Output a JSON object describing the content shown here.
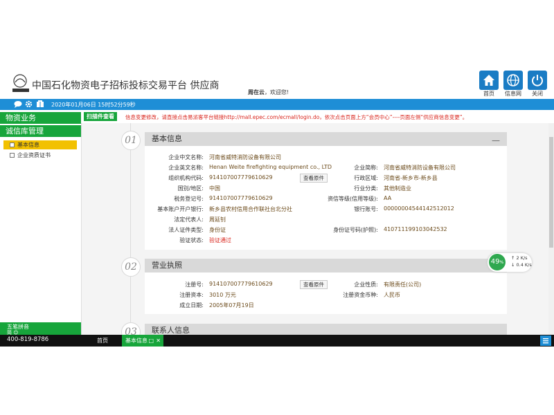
{
  "header": {
    "platform_title": "中国石化物资电子招标投标交易平台 供应商",
    "welcome_name": "周在云",
    "welcome_text": "，欢迎您!",
    "buttons": [
      {
        "label": "首页",
        "icon": "home-icon"
      },
      {
        "label": "信息网",
        "icon": "globe-icon"
      },
      {
        "label": "关闭",
        "icon": "power-icon"
      }
    ]
  },
  "topbar": {
    "datetime": "2020年01月06日 15时52分59秒",
    "icons": [
      "chat-icon",
      "gear-icon",
      "book-icon"
    ]
  },
  "sidebar": {
    "sections": [
      "物资业务",
      "诚信库管理"
    ],
    "items": [
      {
        "label": "基本信息",
        "active": true
      },
      {
        "label": "企业资质证书",
        "active": false
      }
    ],
    "ime_label": "五笔拼音",
    "ime_sub": "简 ☺"
  },
  "tabsrow": {
    "scan_tag": "扫描件查看",
    "notice": "信息变更修改，请直接点击易派客平台链接http://mall.epec.com/ecmall/login.do，依次点击页面上方“会员中心”----页面左侧“供应商信息变更”。"
  },
  "sections": {
    "basic": {
      "num": "01",
      "title": "基本信息",
      "toggle": "—",
      "fields": {
        "cn_name_label": "企业中文名称:",
        "cn_name": "河南省威特消防设备有限公司",
        "en_name_label": "企业英文名称:",
        "en_name": "Henan Weite firefighting equipment co., LTD",
        "short_name_label": "企业简称:",
        "short_name": "河南省威特消防设备有限公司",
        "org_code_label": "组织机构代码:",
        "org_code": "914107007779610629",
        "view_btn": "查看原件",
        "region_label": "行政区域:",
        "region": "河南省-新乡市-新乡县",
        "country_label": "国别/地区:",
        "country": "中国",
        "industry_label": "行业分类:",
        "industry": "其他制造业",
        "tax_label": "税务登记号:",
        "tax": "914107007779610629",
        "credit_label": "资信等级(信用等级):",
        "credit": "AA",
        "bank_label": "基本账户开户银行:",
        "bank": "新乡县农村信用合作联社台北分社",
        "account_label": "银行账号:",
        "account": "00000004544142512012",
        "legal_label": "法定代表人:",
        "legal": "周延钊",
        "cert_type_label": "法人证件类型:",
        "cert_type": "身份证",
        "id_label": "身份证号码(护照):",
        "id": "410711199103042532",
        "verify_label": "验证状态:",
        "verify": "验证通过"
      }
    },
    "license": {
      "num": "02",
      "title": "营业执照",
      "toggle": "—",
      "fields": {
        "reg_label": "注册号:",
        "reg": "914107007779610629",
        "view_btn": "查看原件",
        "nature_label": "企业性质:",
        "nature": "有限责任(公司)",
        "capital_label": "注册资本:",
        "capital": "3010 万元",
        "currency_label": "注册资金币种:",
        "currency": "人民币",
        "date_label": "成立日期:",
        "date": "2005年07月19日"
      }
    },
    "contact": {
      "num": "03",
      "title": "联系人信息"
    }
  },
  "speed": {
    "percent": "49",
    "percent_unit": "%",
    "up": "2 K/s",
    "down": "0.4 K/s"
  },
  "bottombar": {
    "phone": "400-819-8786",
    "tab_home": "首页",
    "tab_basic": "基本信息",
    "tab_basic_max": "□",
    "tab_basic_close": "✕"
  },
  "colors": {
    "brand_green": "#17a53b",
    "brand_blue": "#1e8ed6",
    "active_yellow": "#f2c100",
    "notice_red": "#d9251c"
  }
}
